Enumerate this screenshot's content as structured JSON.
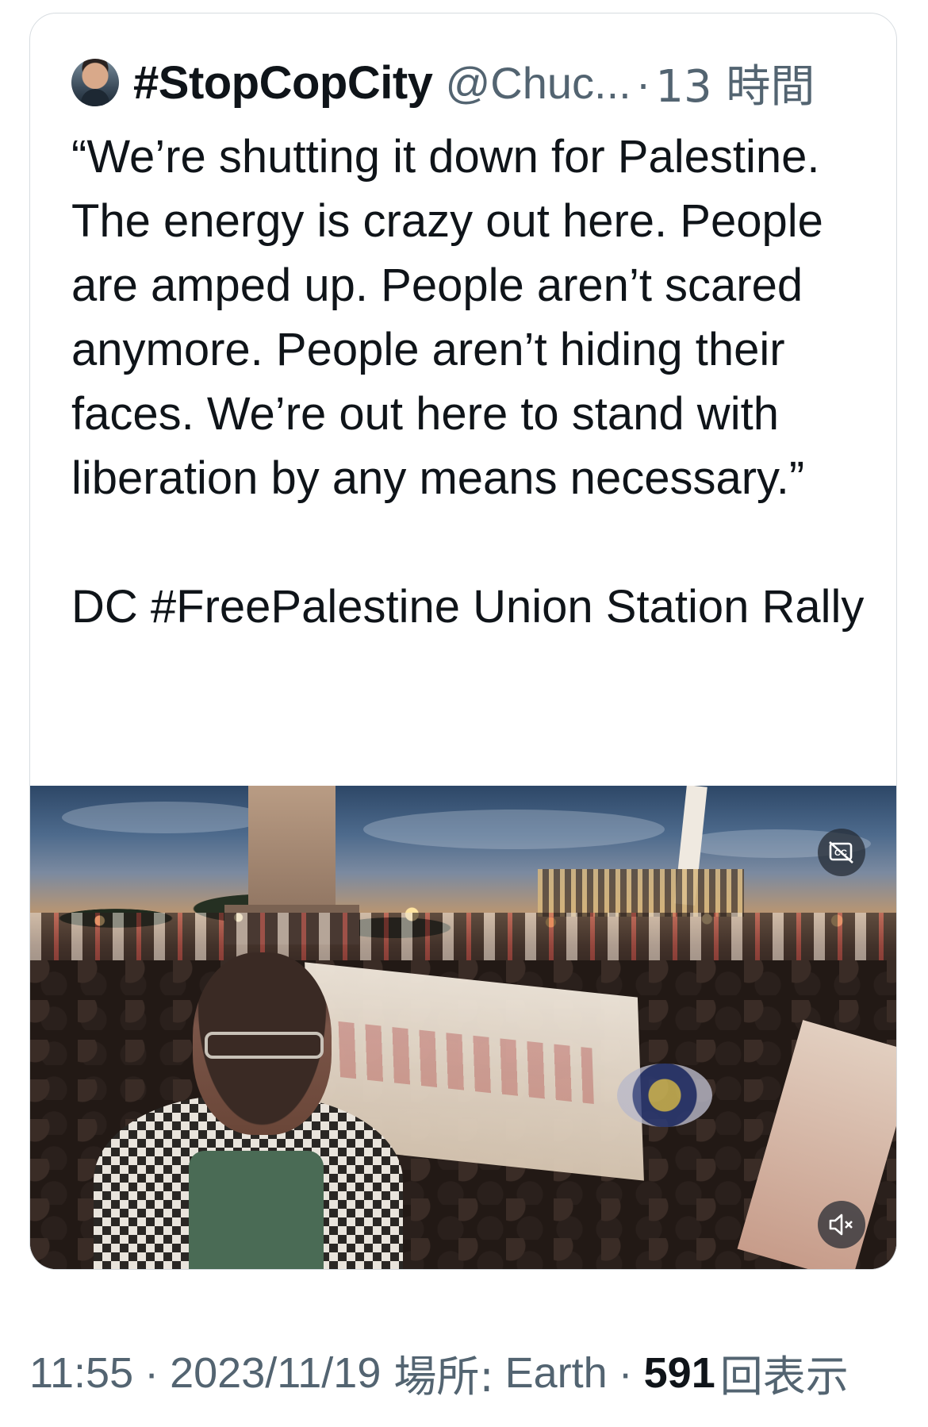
{
  "quoted_tweet": {
    "display_name": "#StopCopCity",
    "handle": "@Chuc...",
    "separator": "·",
    "time_ago": "13 時間",
    "text": "“We’re shutting it down for Palestine. The energy is crazy out here. People are amped up. People aren’t scared anymore. People aren’t hiding their faces. We’re out here to stand with liberation by any means necessary.”\n\nDC #FreePalestine Union Station Rally",
    "media": {
      "type": "video",
      "captions_icon": "captions-off-icon",
      "mute_icon": "speaker-muted-icon"
    }
  },
  "footer": {
    "time": "11:55",
    "date": "2023/11/19",
    "location_label": "場所:",
    "location": "Earth",
    "views_count": "591",
    "views_label": "回表示",
    "separator": "·"
  },
  "colors": {
    "text_primary": "#0f1419",
    "text_secondary": "#536471",
    "border": "#d7dce0"
  }
}
